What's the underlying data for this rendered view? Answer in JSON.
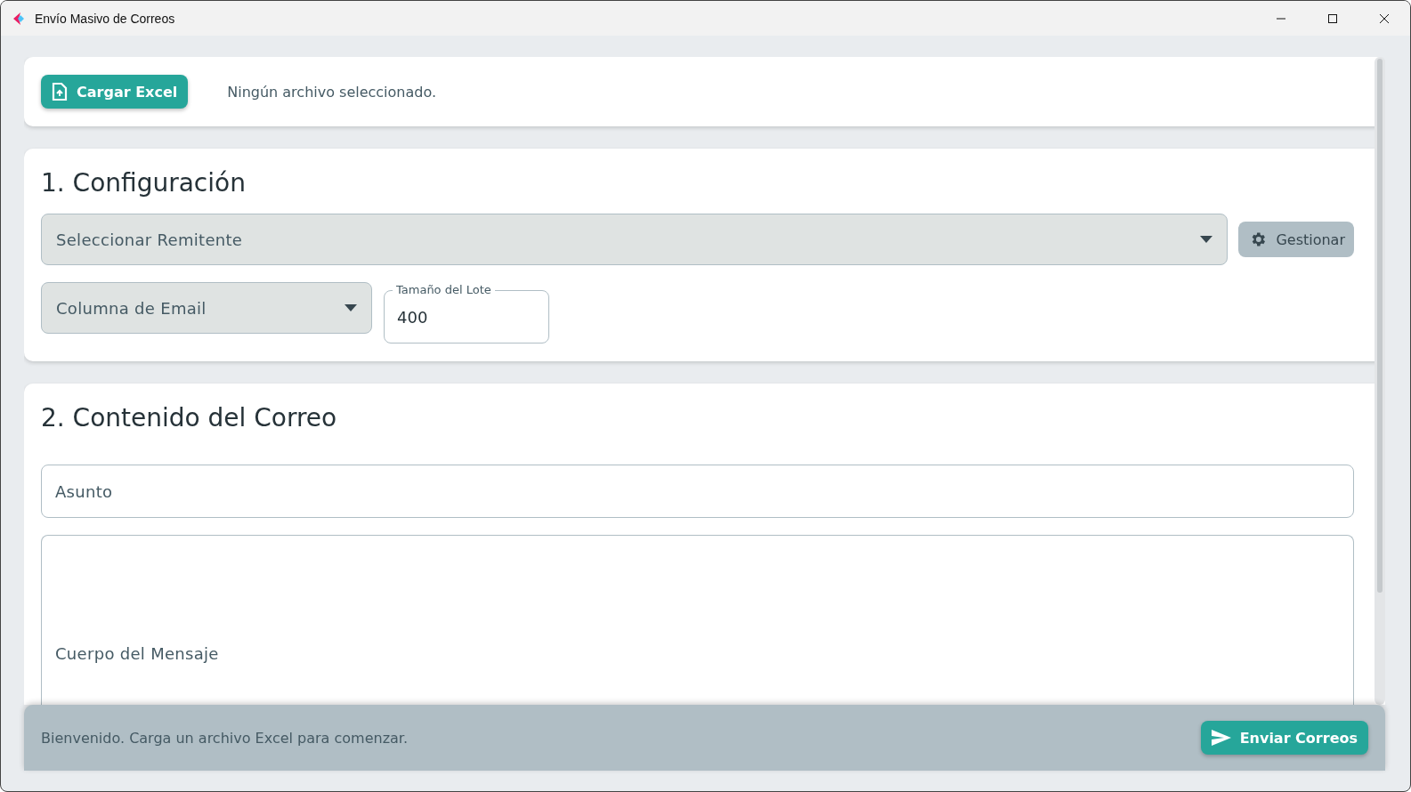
{
  "window": {
    "title": "Envío Masivo de Correos"
  },
  "file_bar": {
    "button": "Cargar Excel",
    "status": "Ningún archivo seleccionado."
  },
  "config": {
    "title": "1. Configuración",
    "sender": {
      "placeholder": "Seleccionar Remitente"
    },
    "manage_button": "Gestionar",
    "email_column": {
      "placeholder": "Columna de Email"
    },
    "batch_size": {
      "label": "Tamaño del Lote",
      "value": "400"
    }
  },
  "content": {
    "title": "2. Contenido del Correo",
    "subject": {
      "placeholder": "Asunto"
    },
    "body": {
      "placeholder": "Cuerpo del Mensaje"
    }
  },
  "footer": {
    "status": "Bienvenido. Carga un archivo Excel para comenzar.",
    "send_button": "Enviar Correos"
  }
}
